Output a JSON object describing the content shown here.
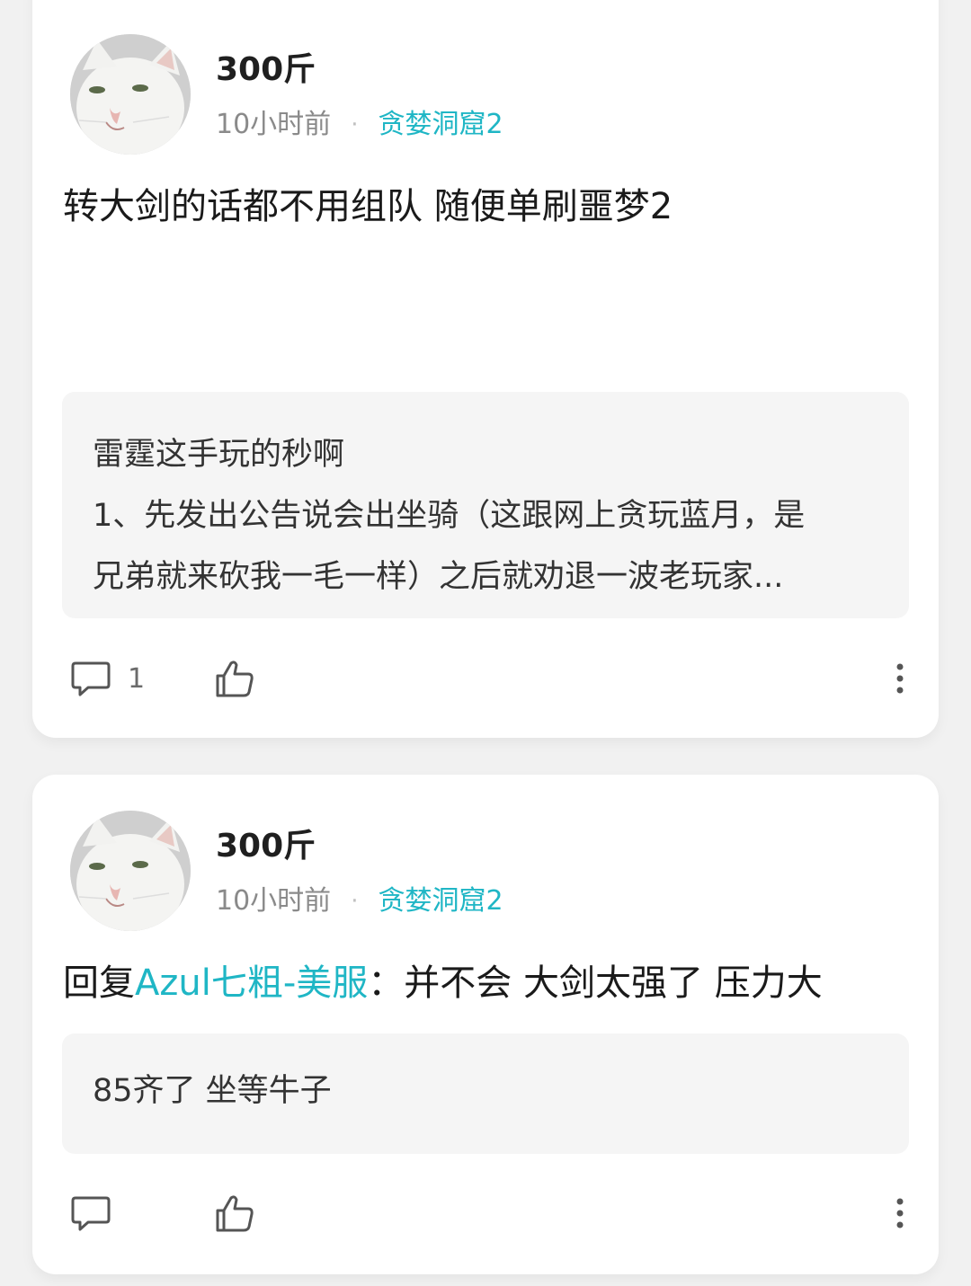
{
  "posts": [
    {
      "username": "300斤",
      "time": "10小时前",
      "separator": "·",
      "forum": "贪婪洞窟2",
      "content": "转大剑的话都不用组队 随便单刷噩梦2",
      "quote_lines": [
        "雷霆这手玩的秒啊",
        "1、先发出公告说会出坐骑（这跟网上贪玩蓝月，是",
        "兄弟就来砍我一毛一样）之后就劝退一波老玩家..."
      ],
      "comment_count": "1",
      "icons": {
        "avatar": "cat-avatar",
        "comment": "comment-icon",
        "like": "thumbs-up-icon",
        "more": "more-vertical-icon"
      }
    },
    {
      "username": "300斤",
      "time": "10小时前",
      "separator": "·",
      "forum": "贪婪洞窟2",
      "reply_prefix": "回复",
      "reply_mention": "Azul七粗-美服",
      "reply_text": "：并不会 大剑太强了 压力大",
      "quote_lines": [
        "85齐了 坐等牛子"
      ],
      "icons": {
        "avatar": "cat-avatar",
        "comment": "comment-icon",
        "like": "thumbs-up-icon",
        "more": "more-vertical-icon"
      }
    }
  ],
  "colors": {
    "accent": "#1fb6c5",
    "background": "#f1f1f1",
    "card": "#ffffff",
    "quote_bg": "#f5f5f5"
  }
}
